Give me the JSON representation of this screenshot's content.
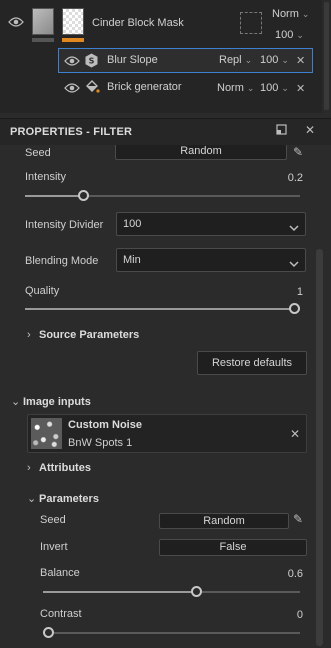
{
  "layers": {
    "top_layer": {
      "name": "Cinder Block Mask",
      "blend": "Norm",
      "opacity": "100"
    },
    "blur_slope": {
      "name": "Blur Slope",
      "blend": "Repl",
      "opacity": "100"
    },
    "brick": {
      "name": "Brick generator",
      "blend": "Norm",
      "opacity": "100"
    }
  },
  "panel": {
    "title": "PROPERTIES - FILTER"
  },
  "filter": {
    "seed_label": "Seed",
    "seed_button": "Random",
    "intensity_label": "Intensity",
    "intensity_value": "0.2",
    "intensity_fraction": 0.2,
    "intensity_divider_label": "Intensity Divider",
    "intensity_divider_value": "100",
    "blending_mode_label": "Blending Mode",
    "blending_mode_value": "Min",
    "quality_label": "Quality",
    "quality_value": "1",
    "quality_fraction": 1.0,
    "source_parameters": "Source Parameters",
    "restore_defaults": "Restore defaults"
  },
  "image_inputs": {
    "section": "Image inputs",
    "input_name": "Custom Noise",
    "input_sub": "BnW Spots 1",
    "attributes": "Attributes",
    "parameters": "Parameters",
    "seed_label": "Seed",
    "seed_button": "Random",
    "invert_label": "Invert",
    "invert_value": "False",
    "balance_label": "Balance",
    "balance_value": "0.6",
    "balance_fraction": 0.6,
    "contrast_label": "Contrast",
    "contrast_value": "0",
    "contrast_fraction": 0.0
  },
  "colors": {
    "accent": "#e0871f",
    "selection": "#3f7fd0",
    "background": "#2b2b2b"
  },
  "icons": [
    "eye-icon",
    "smart-filter-icon",
    "fill-bucket-icon",
    "close-icon",
    "chevron-down-icon",
    "pencil-icon",
    "maximize-icon",
    "chevron-right-icon"
  ]
}
